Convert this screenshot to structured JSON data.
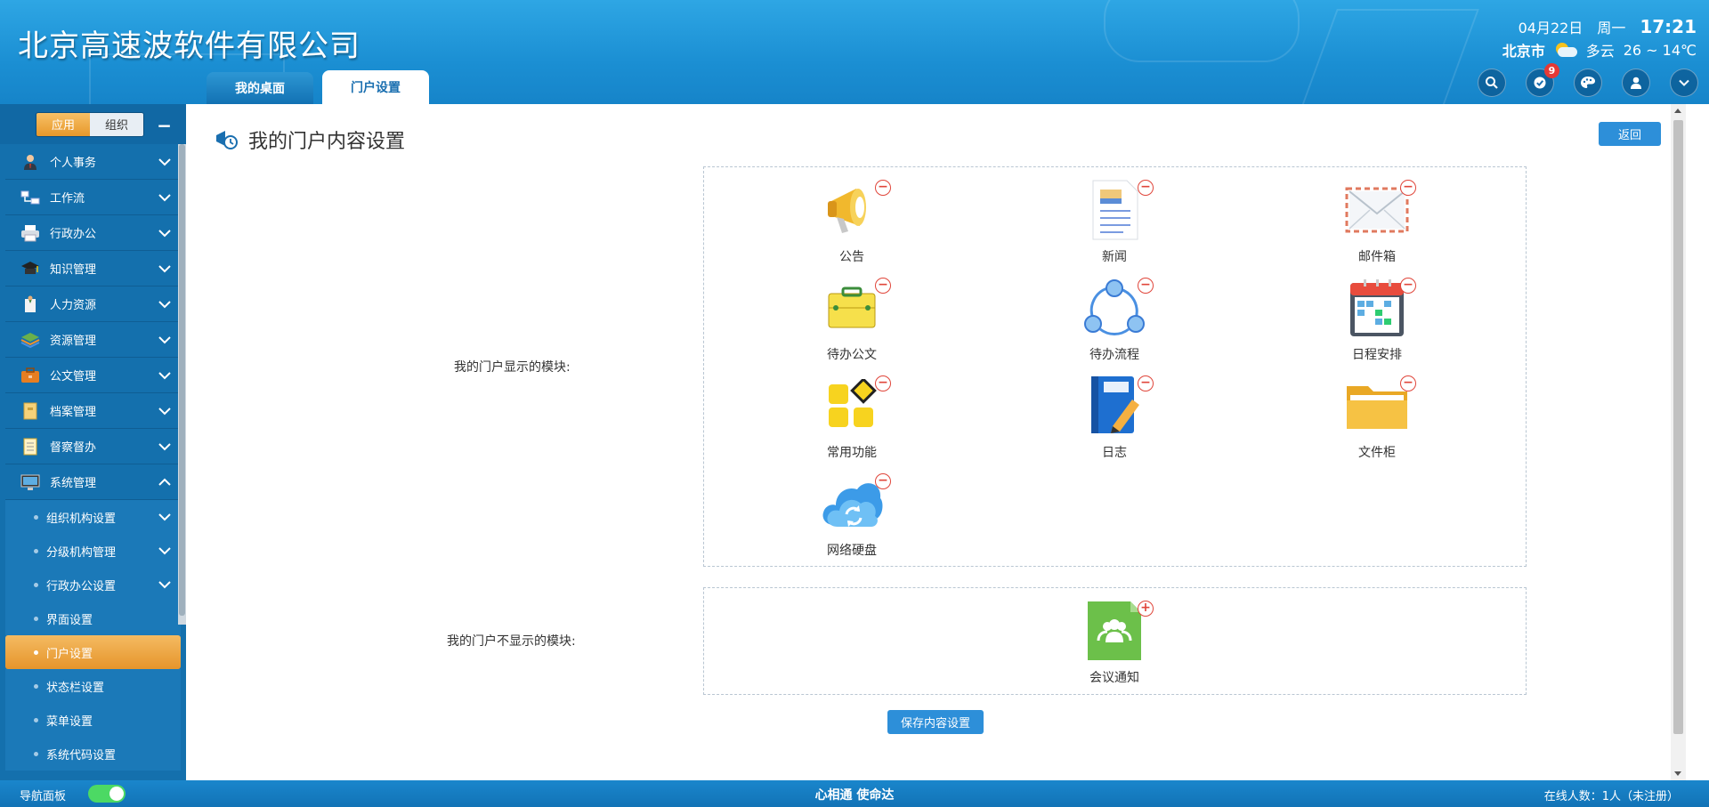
{
  "header": {
    "company": "北京高速波软件有限公司",
    "tabs": [
      "我的桌面",
      "门户设置"
    ],
    "date": "04月22日",
    "weekday": "周一",
    "time": "17:21",
    "city": "北京市",
    "weather": "多云",
    "temp": "26 ~ 14℃",
    "notification_count": "9",
    "icons": [
      "search-icon",
      "check-badge-icon",
      "palette-icon",
      "user-icon",
      "chevron-down-icon"
    ]
  },
  "sidebar": {
    "switch": [
      "应用",
      "组织"
    ],
    "collapse": "−",
    "menu": [
      {
        "label": "个人事务",
        "icon": "person-icon"
      },
      {
        "label": "工作流",
        "icon": "workflow-icon"
      },
      {
        "label": "行政办公",
        "icon": "printer-icon"
      },
      {
        "label": "知识管理",
        "icon": "graduation-cap-icon"
      },
      {
        "label": "人力资源",
        "icon": "hr-icon"
      },
      {
        "label": "资源管理",
        "icon": "layers-icon"
      },
      {
        "label": "公文管理",
        "icon": "briefcase-icon"
      },
      {
        "label": "档案管理",
        "icon": "archive-icon"
      },
      {
        "label": "督察督办",
        "icon": "checklist-icon"
      },
      {
        "label": "系统管理",
        "icon": "monitor-icon"
      }
    ],
    "submenu": [
      {
        "label": "组织机构设置",
        "expandable": true
      },
      {
        "label": "分级机构管理",
        "expandable": true
      },
      {
        "label": "行政办公设置",
        "expandable": true
      },
      {
        "label": "界面设置",
        "expandable": false
      },
      {
        "label": "门户设置",
        "expandable": false,
        "selected": true
      },
      {
        "label": "状态栏设置",
        "expandable": false
      },
      {
        "label": "菜单设置",
        "expandable": false
      },
      {
        "label": "系统代码设置",
        "expandable": false
      }
    ]
  },
  "main": {
    "title": "我的门户内容设置",
    "back_label": "返回",
    "shown_label": "我的门户显示的模块:",
    "hidden_label": "我的门户不显示的模块:",
    "shown_modules": [
      {
        "label": "公告",
        "icon": "megaphone-icon"
      },
      {
        "label": "新闻",
        "icon": "news-icon"
      },
      {
        "label": "邮件箱",
        "icon": "envelope-icon"
      },
      {
        "label": "待办公文",
        "icon": "briefcase-icon"
      },
      {
        "label": "待办流程",
        "icon": "process-cycle-icon"
      },
      {
        "label": "日程安排",
        "icon": "calendar-icon"
      },
      {
        "label": "常用功能",
        "icon": "tiles-icon"
      },
      {
        "label": "日志",
        "icon": "journal-icon"
      },
      {
        "label": "文件柜",
        "icon": "folder-icon"
      },
      {
        "label": "网络硬盘",
        "icon": "cloud-sync-icon"
      }
    ],
    "hidden_modules": [
      {
        "label": "会议通知",
        "icon": "meeting-icon"
      }
    ],
    "remove_symbol": "−",
    "add_symbol": "+",
    "save_label": "保存内容设置"
  },
  "footer": {
    "nav_label": "导航面板",
    "slogan": "心相通 使命达",
    "online": "在线人数：1人（未注册）"
  },
  "colors": {
    "header_blue": "#1b8fd3",
    "sidebar_blue": "#1470ad",
    "accent_orange": "#e6952b",
    "button_blue": "#2d8fd9",
    "remove_red": "#e0453a"
  }
}
